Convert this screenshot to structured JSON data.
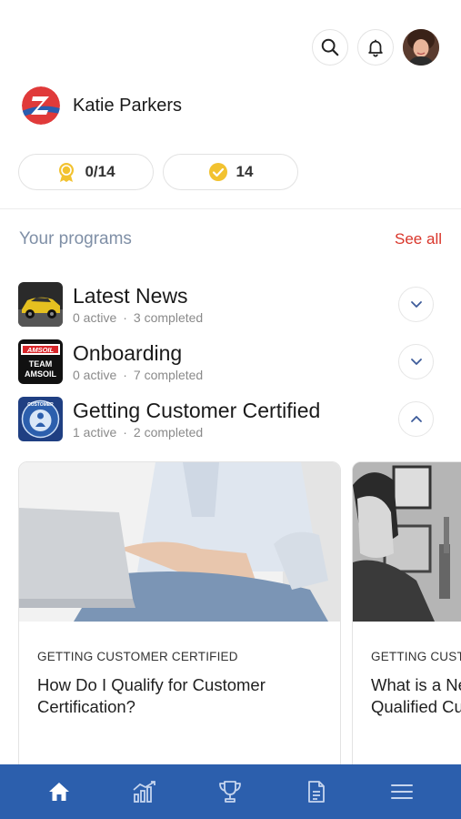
{
  "header": {
    "search_icon": "search-icon",
    "notification_icon": "bell-icon",
    "avatar_icon": "user-avatar"
  },
  "profile": {
    "name": "Katie Parkers"
  },
  "stats": {
    "badges": "0/14",
    "completed": "14"
  },
  "programs_section": {
    "title": "Your programs",
    "see_all": "See all"
  },
  "programs": [
    {
      "name": "Latest News",
      "active": "0 active",
      "completed": "3 completed",
      "expanded": false
    },
    {
      "name": "Onboarding",
      "active": "0 active",
      "completed": "7 completed",
      "expanded": false
    },
    {
      "name": "Getting Customer Certified",
      "active": "1 active",
      "completed": "2 completed",
      "expanded": true
    }
  ],
  "program_logos": {
    "onboarding_line1": "AMSOIL",
    "onboarding_line2": "TEAM",
    "onboarding_line3": "AMSOIL",
    "certified_text": "CUSTOMER"
  },
  "cards": [
    {
      "category": "GETTING CUSTOMER CERTIFIED",
      "title": "How Do I Qualify for Customer Certification?"
    },
    {
      "category": "GETTING CUSTOMER CERTIFIED",
      "title_line1": "What is a New",
      "title_line2": "Qualified Customer?"
    }
  ],
  "nav": [
    "home-icon",
    "chart-icon",
    "trophy-icon",
    "document-icon",
    "menu-icon"
  ],
  "colors": {
    "accent_red": "#d9352a",
    "nav_blue": "#2c5fad",
    "section_gray": "#7f8fa6",
    "badge_gold": "#f2c230"
  }
}
